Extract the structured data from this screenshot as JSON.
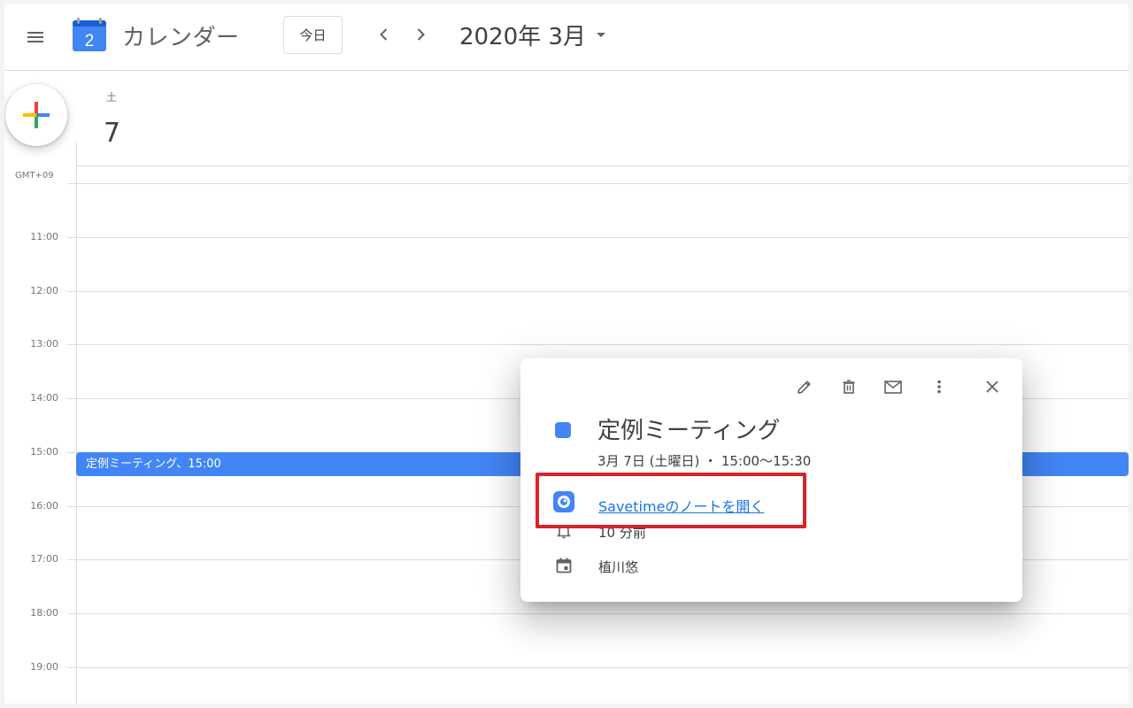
{
  "header": {
    "app_title": "カレンダー",
    "logo_day": "2",
    "today_label": "今日",
    "date_title": "2020年 3月"
  },
  "day": {
    "weekday": "土",
    "number": "7"
  },
  "timezone": "GMT+09",
  "hours": [
    "11:00",
    "12:00",
    "13:00",
    "14:00",
    "15:00",
    "16:00",
    "17:00",
    "18:00",
    "19:00"
  ],
  "event_bar": {
    "label": "定例ミーティング、15:00"
  },
  "popup": {
    "title": "定例ミーティング",
    "time": "3月 7日 (土曜日) ・ 15:00〜15:30",
    "link_text": "Savetimeのノートを開く",
    "reminder": "10 分前",
    "owner": "植川悠"
  },
  "colors": {
    "event": "#4285f4",
    "link": "#1a73e8",
    "highlight": "#d8232a"
  },
  "icons": {
    "menu": "hamburger-menu-icon",
    "prev": "chevron-left-icon",
    "next": "chevron-right-icon",
    "caret": "caret-down-icon",
    "create": "plus-icon",
    "edit": "pencil-icon",
    "delete": "trash-icon",
    "mail": "mail-icon",
    "more": "more-vert-icon",
    "close": "close-icon",
    "savetime": "savetime-app-icon",
    "reminder": "bell-icon",
    "calendar": "calendar-icon"
  }
}
